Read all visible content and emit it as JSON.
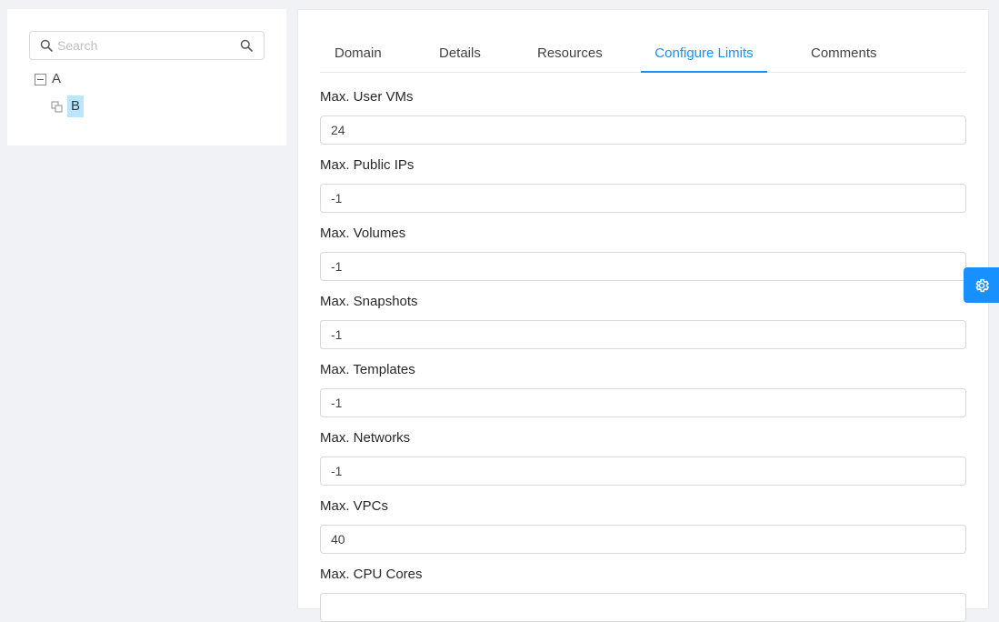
{
  "search": {
    "placeholder": "Search",
    "value": ""
  },
  "tree": {
    "nodes": [
      {
        "label": "A",
        "expanded": true
      },
      {
        "label": "B",
        "selected": true
      }
    ]
  },
  "tabs": [
    {
      "label": "Domain"
    },
    {
      "label": "Details"
    },
    {
      "label": "Resources"
    },
    {
      "label": "Configure Limits",
      "active": true
    },
    {
      "label": "Comments"
    }
  ],
  "limits": [
    {
      "label": "Max. User VMs",
      "value": "24"
    },
    {
      "label": "Max. Public IPs",
      "value": "-1"
    },
    {
      "label": "Max. Volumes",
      "value": "-1"
    },
    {
      "label": "Max. Snapshots",
      "value": "-1"
    },
    {
      "label": "Max. Templates",
      "value": "-1"
    },
    {
      "label": "Max. Networks",
      "value": "-1"
    },
    {
      "label": "Max. VPCs",
      "value": "40"
    },
    {
      "label": "Max. CPU Cores",
      "value": ""
    }
  ],
  "icons": {
    "search_prefix": "search-icon",
    "search_suffix": "search-icon",
    "tree_switcher": "minus-square-icon",
    "tree_leaf": "copy-icon",
    "settings": "gear-icon"
  },
  "colors": {
    "accent": "#1890ff",
    "selected_bg": "#bae7ff"
  }
}
